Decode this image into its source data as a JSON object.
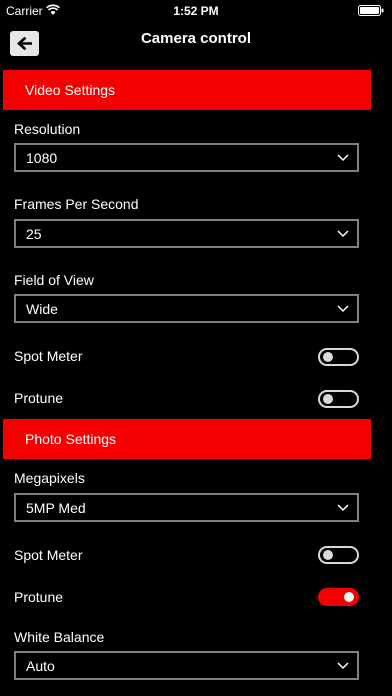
{
  "status_bar": {
    "carrier": "Carrier",
    "time": "1:52 PM"
  },
  "nav": {
    "title": "Camera control",
    "back_icon": "arrow-left-icon"
  },
  "video_settings": {
    "header": "Video Settings",
    "resolution": {
      "label": "Resolution",
      "value": "1080"
    },
    "fps": {
      "label": "Frames Per Second",
      "value": "25"
    },
    "fov": {
      "label": "Field of View",
      "value": "Wide"
    },
    "spot_meter": {
      "label": "Spot Meter",
      "on": false
    },
    "protune": {
      "label": "Protune",
      "on": false
    }
  },
  "photo_settings": {
    "header": "Photo Settings",
    "megapixels": {
      "label": "Megapixels",
      "value": "5MP Med"
    },
    "spot_meter": {
      "label": "Spot Meter",
      "on": false
    },
    "protune": {
      "label": "Protune",
      "on": true
    },
    "white_balance": {
      "label": "White Balance",
      "value": "Auto"
    }
  },
  "colors": {
    "accent": "#f40000",
    "background": "#000000",
    "border": "#808080"
  }
}
